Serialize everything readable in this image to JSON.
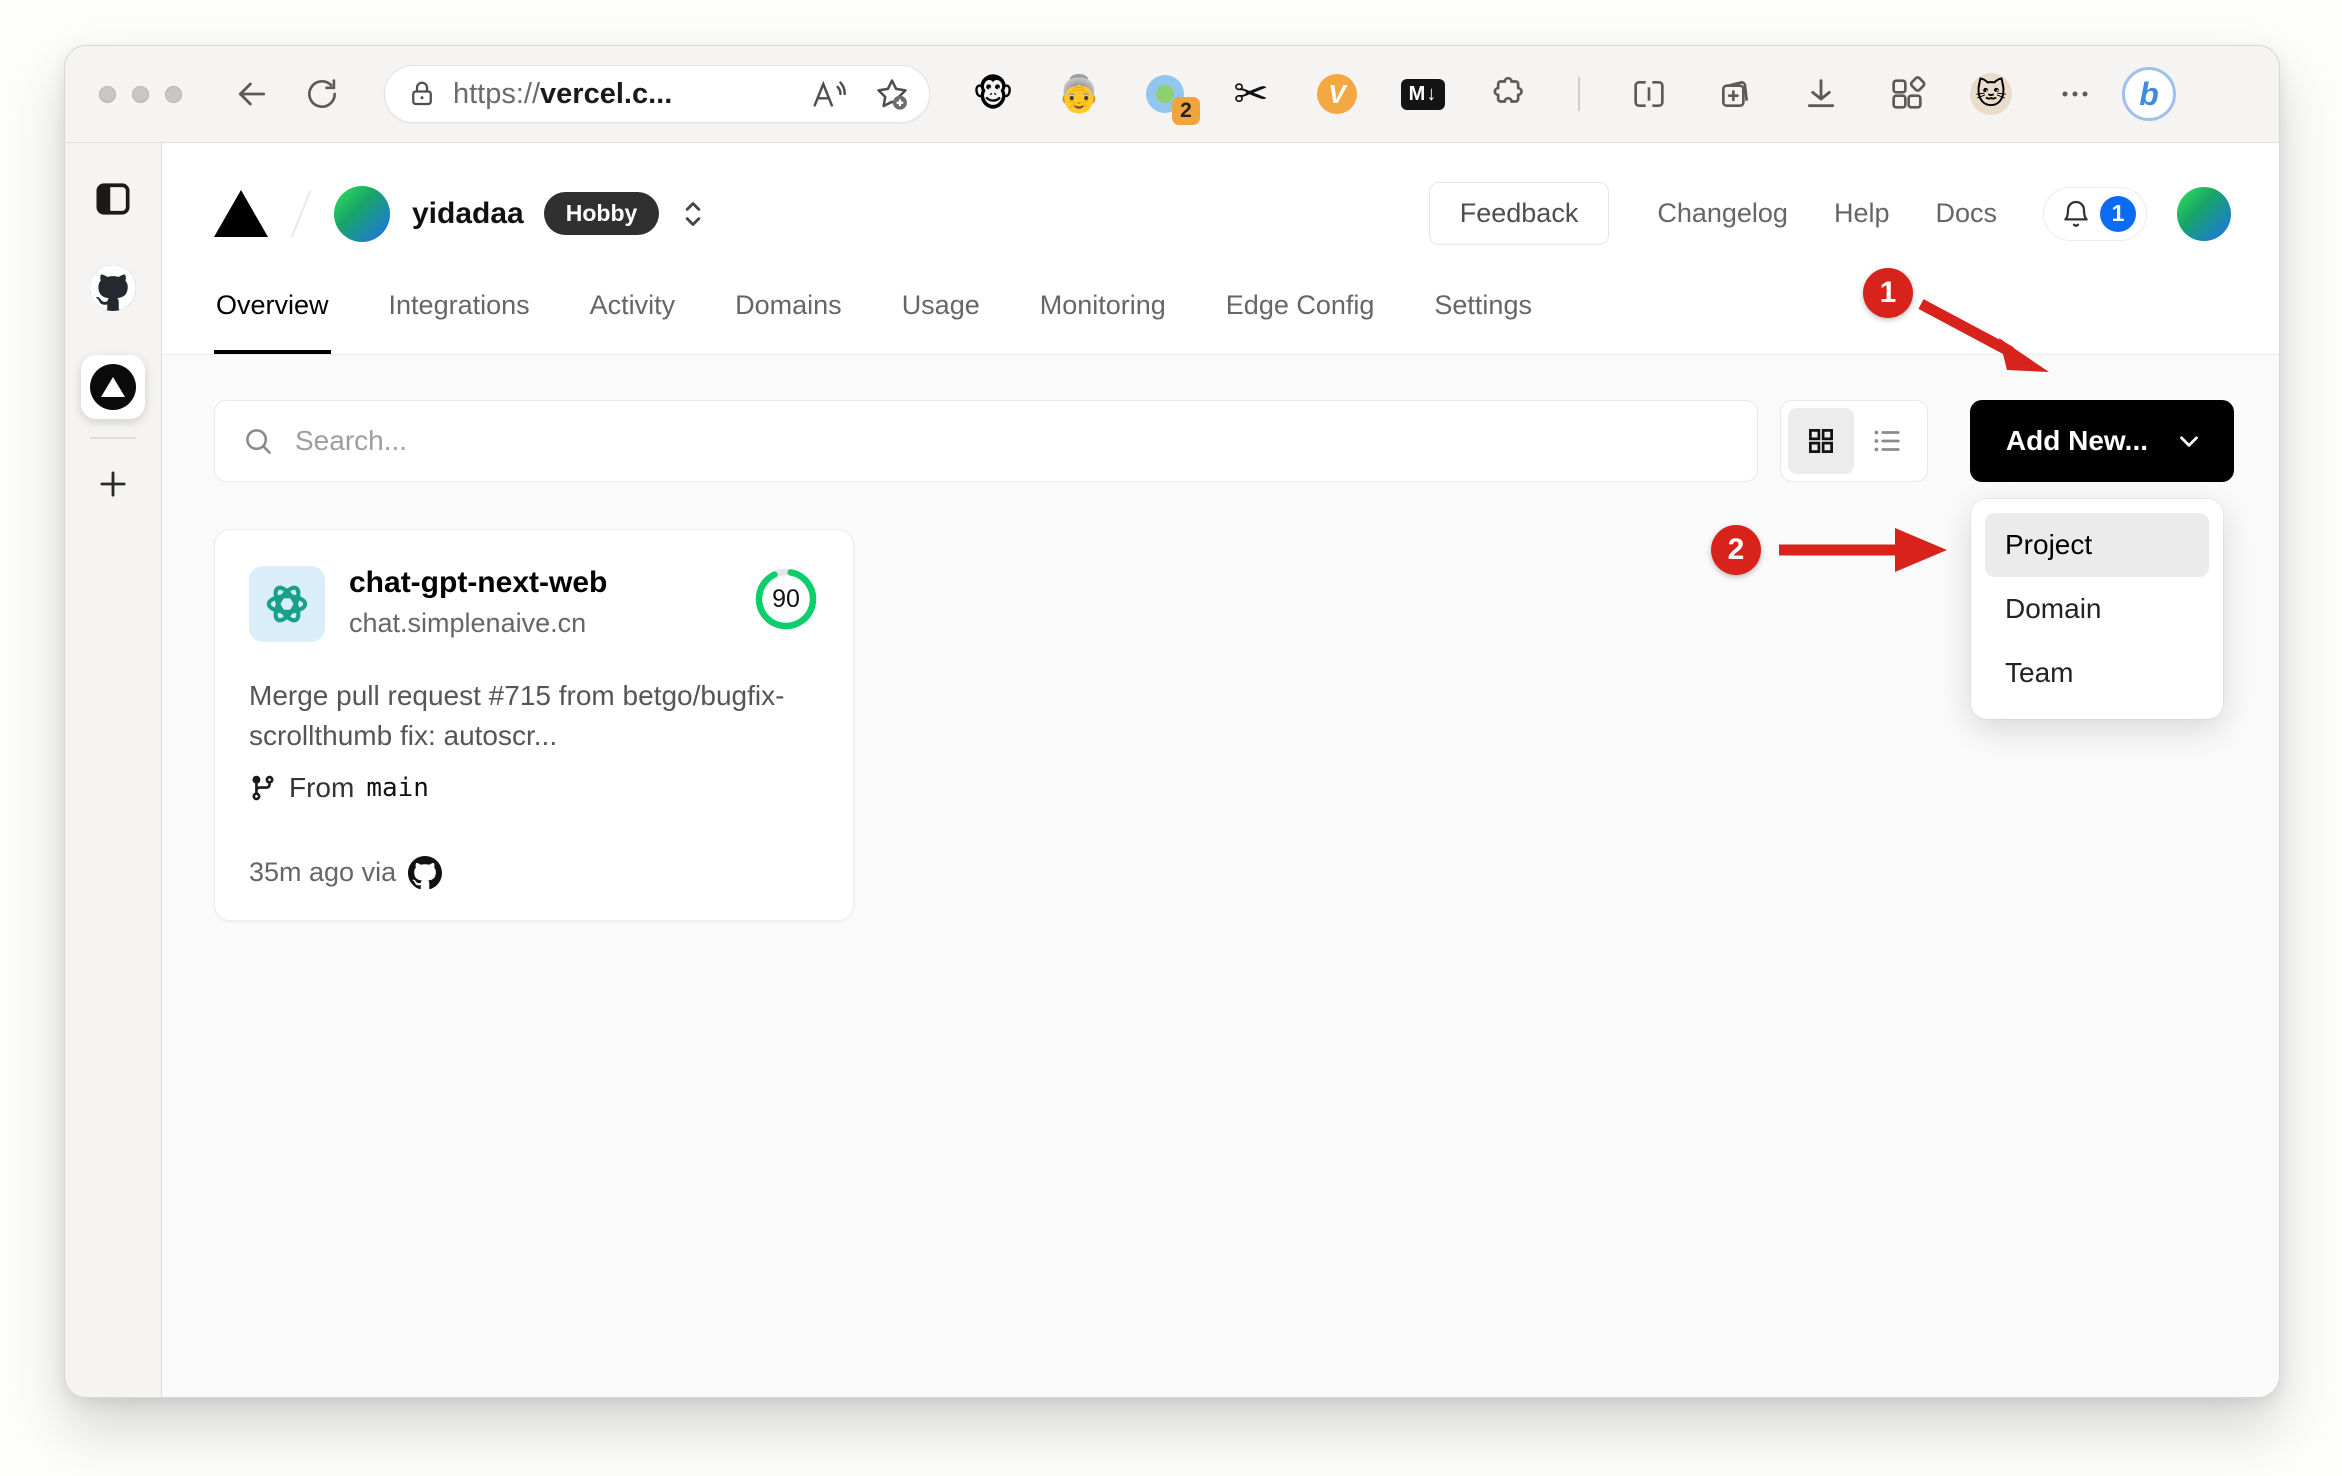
{
  "browser": {
    "url": {
      "scheme": "https://",
      "host": "vercel.c..."
    },
    "extensions": {
      "monkey_glyph": "🐵",
      "grandma_glyph": "👵",
      "badge_count": "2",
      "scissors_glyph": "✂",
      "v_label": "V",
      "markdown_label": "M↓",
      "cat_glyph": "🐱",
      "bing_label": "b"
    }
  },
  "header": {
    "team_name": "yidadaa",
    "plan_badge": "Hobby",
    "feedback_label": "Feedback",
    "links": [
      "Changelog",
      "Help",
      "Docs"
    ],
    "notification_count": "1"
  },
  "tabs": [
    "Overview",
    "Integrations",
    "Activity",
    "Domains",
    "Usage",
    "Monitoring",
    "Edge Config",
    "Settings"
  ],
  "toolbar": {
    "search_placeholder": "Search...",
    "add_new_label": "Add New..."
  },
  "dropdown": {
    "items": [
      "Project",
      "Domain",
      "Team"
    ],
    "active_item": "Project"
  },
  "project_card": {
    "name": "chat-gpt-next-web",
    "domain": "chat.simplenaive.cn",
    "score": "90",
    "commit_message": "Merge pull request #715 from betgo/bugfix-scrollthumb fix: autoscr...",
    "branch_prefix": "From",
    "branch": "main",
    "time": "35m ago via"
  },
  "annotations": {
    "step1": "1",
    "step2": "2"
  },
  "colors": {
    "accent_red": "#d7231b",
    "score_green": "#0cce6b",
    "notification_blue": "#0b6cf0",
    "button_black": "#000000"
  }
}
